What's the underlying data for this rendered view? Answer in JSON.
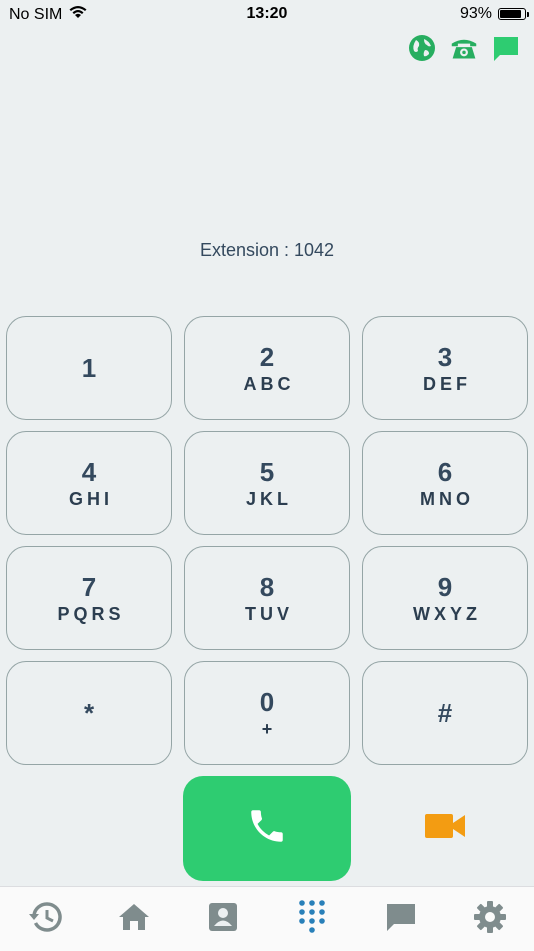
{
  "status_bar": {
    "carrier": "No SIM",
    "time": "13:20",
    "battery_percent": "93%",
    "battery_level": 0.93,
    "wifi_icon": "wifi-icon"
  },
  "header_icons": [
    {
      "name": "globe-icon",
      "color": "#27ae60"
    },
    {
      "name": "phone-icon",
      "color": "#27ae60"
    },
    {
      "name": "chat-icon",
      "color": "#2ecc71"
    }
  ],
  "extension_label": "Extension : 1042",
  "keypad": [
    {
      "digit": "1",
      "letters": ""
    },
    {
      "digit": "2",
      "letters": "ABC"
    },
    {
      "digit": "3",
      "letters": "DEF"
    },
    {
      "digit": "4",
      "letters": "GHI"
    },
    {
      "digit": "5",
      "letters": "JKL"
    },
    {
      "digit": "6",
      "letters": "MNO"
    },
    {
      "digit": "7",
      "letters": "PQRS"
    },
    {
      "digit": "8",
      "letters": "TUV"
    },
    {
      "digit": "9",
      "letters": "WXYZ"
    },
    {
      "digit": "*",
      "letters": ""
    },
    {
      "digit": "0",
      "letters": "+"
    },
    {
      "digit": "#",
      "letters": ""
    }
  ],
  "actions": {
    "call_icon": "phone-icon",
    "call_color": "#2ecc71",
    "video_icon": "video-camera-icon",
    "video_color": "#f39c12"
  },
  "tabs": [
    {
      "name": "history-icon",
      "active": false
    },
    {
      "name": "home-icon",
      "active": false
    },
    {
      "name": "contacts-icon",
      "active": false
    },
    {
      "name": "dialpad-icon",
      "active": true
    },
    {
      "name": "messages-icon",
      "active": false
    },
    {
      "name": "settings-icon",
      "active": false
    }
  ],
  "colors": {
    "tab_inactive": "#7f8c8d",
    "tab_active": "#2980b9"
  }
}
